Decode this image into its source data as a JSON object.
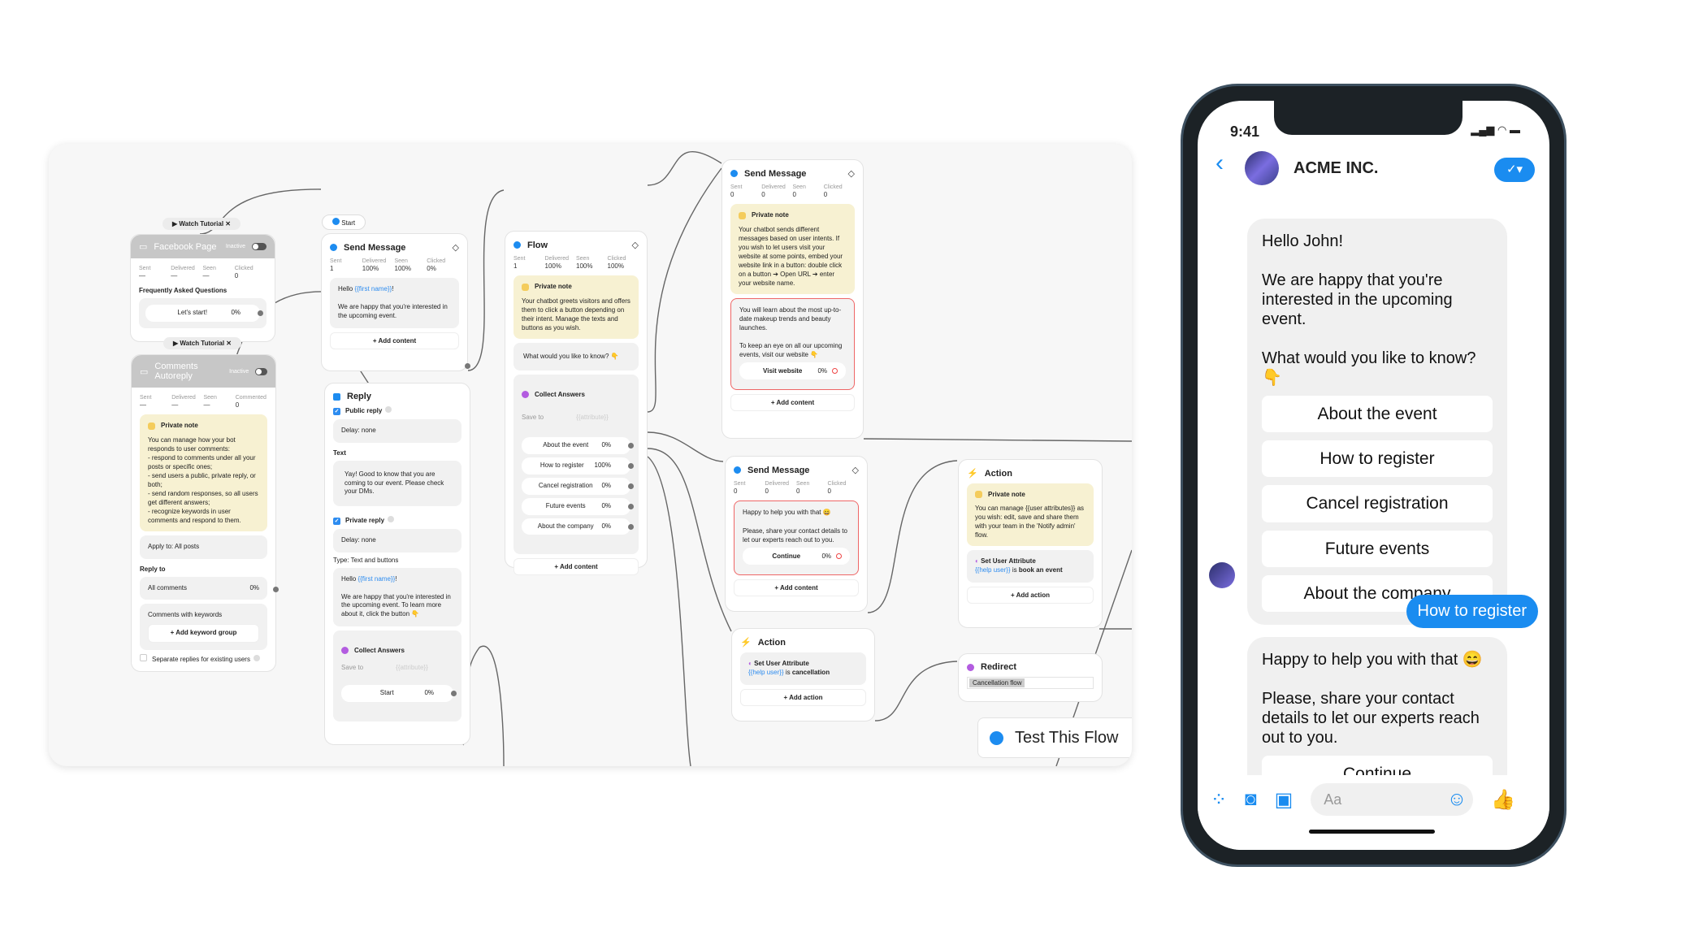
{
  "canvas": {
    "watch_tutorial": "Watch Tutorial",
    "start": "Start",
    "test_flow": "Test This Flow",
    "add_content": "+ Add content",
    "add_action": "+ Add action",
    "private_note": "Private note",
    "facebook_page": {
      "title": "Facebook Page",
      "status": "Inactive",
      "stats": [
        {
          "label": "Sent",
          "value": "—"
        },
        {
          "label": "Delivered",
          "value": "—"
        },
        {
          "label": "Seen",
          "value": "—"
        },
        {
          "label": "Clicked",
          "value": "0"
        }
      ],
      "section": "Frequently Asked Questions",
      "button": "Let's start!",
      "pct": "0%"
    },
    "comments": {
      "title": "Comments Autoreply",
      "status": "Inactive",
      "stats": [
        {
          "label": "Sent",
          "value": "—"
        },
        {
          "label": "Delivered",
          "value": "—"
        },
        {
          "label": "Seen",
          "value": "—"
        },
        {
          "label": "Commented",
          "value": "0"
        }
      ],
      "note": "You can manage how your bot responds to user comments:\n- respond to comments under all your posts or specific ones;\n- send users a public, private reply, or both;\n- send random responses, so all users get different answers;\n- recognize keywords in user comments and respond to them.",
      "apply": "Apply to: All posts",
      "reply_to": "Reply to",
      "all_comments": "All comments",
      "all_pct": "0%",
      "keywords": "Comments with keywords",
      "add_keyword": "+ Add keyword group",
      "separate": "Separate replies for existing users"
    },
    "send1": {
      "title": "Send Message",
      "stats": [
        {
          "label": "Sent",
          "value": "1"
        },
        {
          "label": "Delivered",
          "value": "100%"
        },
        {
          "label": "Seen",
          "value": "100%"
        },
        {
          "label": "Clicked",
          "value": "0%"
        }
      ],
      "hello": "Hello ",
      "var": "{{first name}}",
      "excl": "!",
      "text": "We are happy that you're interested in the upcoming event."
    },
    "reply": {
      "title": "Reply",
      "public": "Public reply",
      "delay": "Delay: none",
      "text_label": "Text",
      "text": "Yay! Good to know that you are coming to our event. Please check your DMs.",
      "private": "Private reply",
      "type_label": "Type:",
      "type": "Text and buttons",
      "hello": "Hello ",
      "var": "{{first name}}",
      "excl": "!",
      "msg": "We are happy that you're interested in the upcoming event. To learn more about it, click the button 👇",
      "collect": "Collect Answers",
      "save_to": "Save to",
      "attr": "{{attribute}}",
      "button": "Start",
      "pct": "0%"
    },
    "flow": {
      "title": "Flow",
      "stats": [
        {
          "label": "Sent",
          "value": "1"
        },
        {
          "label": "Delivered",
          "value": "100%"
        },
        {
          "label": "Seen",
          "value": "100%"
        },
        {
          "label": "Clicked",
          "value": "100%"
        }
      ],
      "note": "Your chatbot greets visitors and offers them to click a button depending on their intent. Manage the texts and buttons as you wish.",
      "question": "What would you like to know? 👇",
      "collect": "Collect Answers",
      "save_to": "Save to",
      "attr": "{{attribute}}",
      "buttons": [
        {
          "label": "About the event",
          "pct": "0%"
        },
        {
          "label": "How to register",
          "pct": "100%"
        },
        {
          "label": "Cancel registration",
          "pct": "0%"
        },
        {
          "label": "Future events",
          "pct": "0%"
        },
        {
          "label": "About the company",
          "pct": "0%"
        }
      ]
    },
    "send2": {
      "title": "Send Message",
      "stats": [
        {
          "label": "Sent",
          "value": "0"
        },
        {
          "label": "Delivered",
          "value": "0"
        },
        {
          "label": "Seen",
          "value": "0"
        },
        {
          "label": "Clicked",
          "value": "0"
        }
      ],
      "note": "Your chatbot sends different messages based on user intents. If you wish to let users visit your website at some points, embed your website link in a button: double click on a button ➔ Open URL ➔ enter your website name.",
      "text": "You will learn about the most up-to-date makeup trends and beauty launches.\n\nTo keep an eye on all our upcoming events, visit our website 👇",
      "button": "Visit website",
      "pct": "0%"
    },
    "send3": {
      "title": "Send Message",
      "stats": [
        {
          "label": "Sent",
          "value": "0"
        },
        {
          "label": "Delivered",
          "value": "0"
        },
        {
          "label": "Seen",
          "value": "0"
        },
        {
          "label": "Clicked",
          "value": "0"
        }
      ],
      "text": "Happy to help you with that 😄\n\nPlease, share your contact details to let our experts reach out to you.",
      "button": "Continue",
      "pct": "0%"
    },
    "action1": {
      "title": "Action",
      "note": "You can manage {{user attributes}} as you wish: edit, save and share them with your team in the 'Notify admin' flow.",
      "set_attr": "Set User Attribute",
      "var": "{{help user}}",
      "is": " is ",
      "value": "book an event"
    },
    "action2": {
      "title": "Action",
      "set_attr": "Set User Attribute",
      "var": "{{help user}}",
      "is": " is ",
      "value": "cancellation"
    },
    "redirect": {
      "title": "Redirect",
      "target": "Cancellation flow"
    }
  },
  "phone": {
    "time": "9:41",
    "contact": "ACME INC.",
    "greeting": "Hello John!\n\nWe are happy that you're interested in the upcoming event.\n\nWhat would you like to know?👇",
    "quick_replies": [
      "About the event",
      "How to register",
      "Cancel registration",
      "Future events",
      "About the company"
    ],
    "user_message": "How to register",
    "reply": "Happy to help you with that 😄\n\nPlease, share your contact details to let our experts reach out to you.",
    "reply_button": "Continue",
    "input_placeholder": "Aa",
    "accent": "#1a8cf0"
  }
}
